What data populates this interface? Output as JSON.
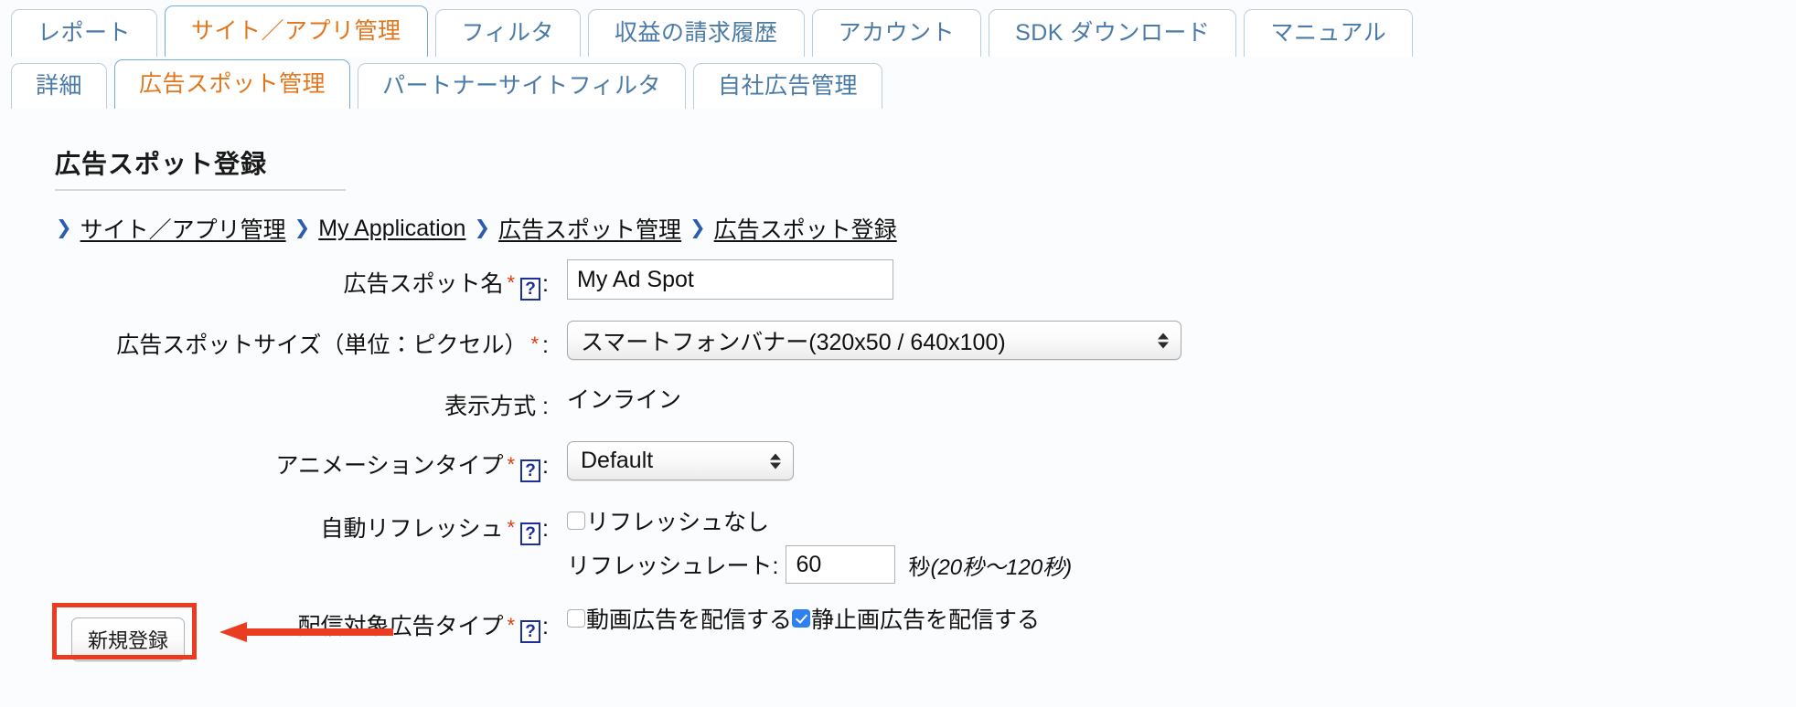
{
  "nav": {
    "primary_tabs": [
      {
        "label": "レポート",
        "active": false
      },
      {
        "label": "サイト／アプリ管理",
        "active": true
      },
      {
        "label": "フィルタ",
        "active": false
      },
      {
        "label": "収益の請求履歴",
        "active": false
      },
      {
        "label": "アカウント",
        "active": false
      },
      {
        "label": "SDK ダウンロード",
        "active": false
      },
      {
        "label": "マニュアル",
        "active": false
      }
    ],
    "secondary_tabs": [
      {
        "label": "詳細",
        "active": false
      },
      {
        "label": "広告スポット管理",
        "active": true
      },
      {
        "label": "パートナーサイトフィルタ",
        "active": false
      },
      {
        "label": "自社広告管理",
        "active": false
      }
    ],
    "active_tab_color": "#e2761c",
    "inactive_tab_color": "#4a7aa7"
  },
  "page": {
    "title": "広告スポット登録"
  },
  "breadcrumb": {
    "separator": "❯",
    "items": [
      "サイト／アプリ管理",
      "My Application",
      "広告スポット管理",
      "広告スポット登録"
    ]
  },
  "form": {
    "required_marker": "*",
    "help_glyph": "?",
    "colon": ":",
    "spot_name": {
      "label": "広告スポット名",
      "value": "My Ad Spot",
      "placeholder": ""
    },
    "spot_size": {
      "label": "広告スポットサイズ（単位：ピクセル）",
      "selected": "スマートフォンバナー(320x50 / 640x100)"
    },
    "display_method": {
      "label": "表示方式",
      "value": "インライン"
    },
    "animation_type": {
      "label": "アニメーションタイプ",
      "selected": "Default"
    },
    "auto_refresh": {
      "label": "自動リフレッシュ",
      "no_refresh_label": "リフレッシュなし",
      "no_refresh_checked": false,
      "rate_label": "リフレッシュレート:",
      "rate_value": "60",
      "unit": "秒",
      "range_note": "(20秒〜120秒)"
    },
    "ad_types": {
      "label": "配信対象広告タイプ",
      "video_label": "動画広告を配信する",
      "video_checked": false,
      "static_label": "静止画広告を配信する",
      "static_checked": true
    },
    "submit_label": "新規登録"
  },
  "annotation": {
    "color": "#ea3c21",
    "highlight_target": "新規登録",
    "arrow_direction": "left"
  }
}
